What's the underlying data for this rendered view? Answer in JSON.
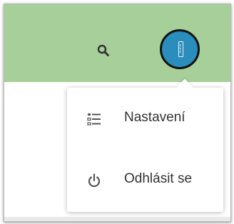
{
  "header": {
    "background_color": "#a6cf9a",
    "search_icon": "search-icon",
    "avatar_icon": "ruler-icon",
    "avatar_color": "#2a8dbb"
  },
  "user_menu": {
    "items": [
      {
        "label": "Nastavení",
        "icon": "list-settings-icon"
      },
      {
        "label": "Odhlásit se",
        "icon": "power-icon"
      }
    ]
  }
}
